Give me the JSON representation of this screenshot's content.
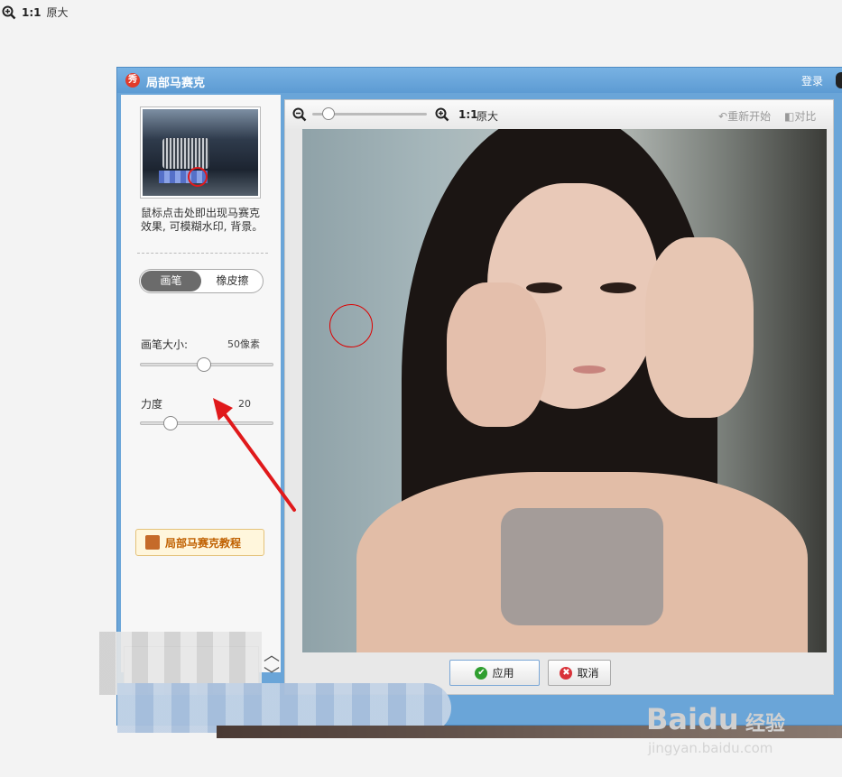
{
  "top_zoom": {
    "ratio": "1:1",
    "label": "原大"
  },
  "window": {
    "title": "局部马赛克",
    "logo_char": "秀",
    "login": "登录"
  },
  "left": {
    "tip": "鼠标点击处即出现马赛克效果, 可模糊水印, 背景。",
    "modes": [
      "画笔",
      "橡皮擦"
    ],
    "active_mode": "画笔",
    "brush_size_label": "画笔大小:",
    "brush_size_value": "50像素",
    "brush_size_fraction": 0.48,
    "strength_label": "力度",
    "strength_value": "20",
    "strength_fraction": 0.2,
    "tutorial_label": "局部马赛克教程"
  },
  "toolbar": {
    "ratio": "1:1",
    "orig_label": "原大",
    "restart": "重新开始",
    "compare": "对比",
    "zoom_fraction": 0.1
  },
  "footer": {
    "apply": "应用",
    "cancel": "取消"
  },
  "watermark": {
    "logo": "Baidu",
    "cn": "经验",
    "url": "jingyan.baidu.com"
  },
  "colors": {
    "title_bar": "#6aa5d8",
    "accent_red": "#e0191b",
    "tutorial_text": "#c06000"
  }
}
